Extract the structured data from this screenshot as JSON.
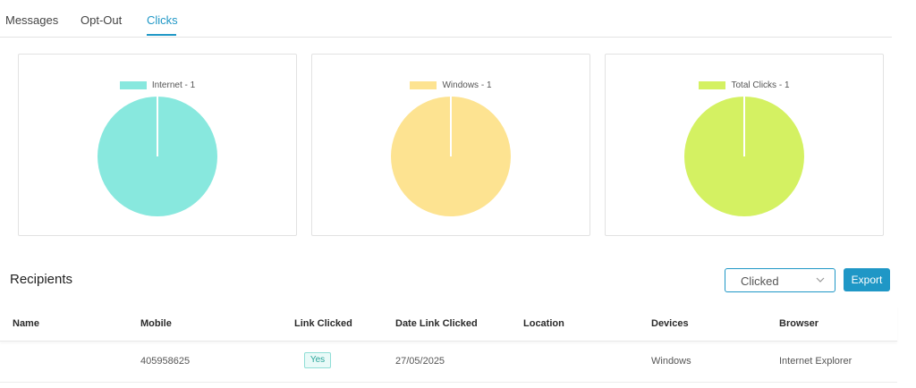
{
  "tabs": [
    {
      "label": "Messages"
    },
    {
      "label": "Opt-Out"
    },
    {
      "label": "Clicks",
      "active": true
    }
  ],
  "charts": [
    {
      "legend": "Internet - 1",
      "color": "#88e8de"
    },
    {
      "legend": "Windows - 1",
      "color": "#fde391"
    },
    {
      "legend": "Total Clicks - 1",
      "color": "#d4f162"
    }
  ],
  "chart_data": [
    {
      "type": "pie",
      "categories": [
        "Internet - 1"
      ],
      "values": [
        1
      ],
      "colors": [
        "#88e8de"
      ]
    },
    {
      "type": "pie",
      "categories": [
        "Windows - 1"
      ],
      "values": [
        1
      ],
      "colors": [
        "#fde391"
      ]
    },
    {
      "type": "pie",
      "categories": [
        "Total Clicks - 1"
      ],
      "values": [
        1
      ],
      "colors": [
        "#d4f162"
      ]
    }
  ],
  "recipients": {
    "title": "Recipients",
    "filter_value": "Clicked",
    "export_label": "Export",
    "columns": [
      "Name",
      "Mobile",
      "Link Clicked",
      "Date Link Clicked",
      "Location",
      "Devices",
      "Browser"
    ],
    "rows": [
      {
        "name": "",
        "mobile": "405958625",
        "link_clicked": "Yes",
        "date": "27/05/2025",
        "location": "",
        "devices": "Windows",
        "browser": "Internet Explorer"
      }
    ]
  },
  "colors": {
    "accent": "#1f97c6",
    "badge_text": "#2aa59a"
  }
}
